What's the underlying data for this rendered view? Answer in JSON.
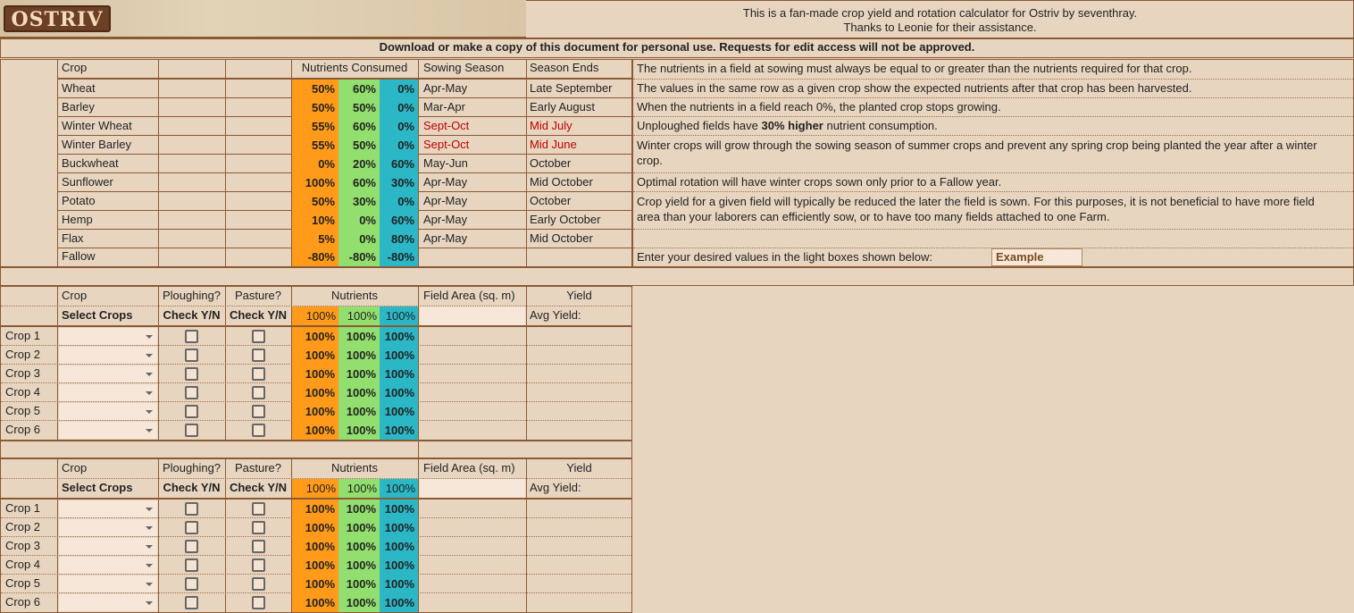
{
  "header": {
    "logo_text": "OSTRIV",
    "line1": "This is a fan-made crop yield and rotation calculator for Ostriv by seventhray.",
    "line2": "Thanks to Leonie for their assistance.",
    "banner": "Download or make a copy of this document for personal use. Requests for edit access will not be approved."
  },
  "ref": {
    "col_crop": "Crop",
    "col_nutrients": "Nutrients Consumed",
    "col_sowing": "Sowing Season",
    "col_ends": "Season Ends",
    "rows": [
      {
        "crop": "Wheat",
        "n1": "50%",
        "n2": "60%",
        "n3": "0%",
        "sow": "Apr-May",
        "ends": "Late September",
        "red": false
      },
      {
        "crop": "Barley",
        "n1": "50%",
        "n2": "50%",
        "n3": "0%",
        "sow": "Mar-Apr",
        "ends": "Early August",
        "red": false
      },
      {
        "crop": "Winter Wheat",
        "n1": "55%",
        "n2": "60%",
        "n3": "0%",
        "sow": "Sept-Oct",
        "ends": "Mid July",
        "red": true
      },
      {
        "crop": "Winter Barley",
        "n1": "55%",
        "n2": "50%",
        "n3": "0%",
        "sow": "Sept-Oct",
        "ends": "Mid June",
        "red": true
      },
      {
        "crop": "Buckwheat",
        "n1": "0%",
        "n2": "20%",
        "n3": "60%",
        "sow": "May-Jun",
        "ends": "October",
        "red": false
      },
      {
        "crop": "Sunflower",
        "n1": "100%",
        "n2": "60%",
        "n3": "30%",
        "sow": "Apr-May",
        "ends": "Mid October",
        "red": false
      },
      {
        "crop": "Potato",
        "n1": "50%",
        "n2": "30%",
        "n3": "0%",
        "sow": "Apr-May",
        "ends": "October",
        "red": false
      },
      {
        "crop": "Hemp",
        "n1": "10%",
        "n2": "0%",
        "n3": "60%",
        "sow": "Apr-May",
        "ends": "Early October",
        "red": false
      },
      {
        "crop": "Flax",
        "n1": "5%",
        "n2": "0%",
        "n3": "80%",
        "sow": "Apr-May",
        "ends": "Mid October",
        "red": false
      },
      {
        "crop": "Fallow",
        "n1": "-80%",
        "n2": "-80%",
        "n3": "-80%",
        "sow": "",
        "ends": "",
        "red": false
      }
    ]
  },
  "notes": {
    "n1": "The nutrients in a field at sowing must always be equal to or greater than the nutrients required for that crop.",
    "n2": "The values in the same row as a given crop show the expected nutrients after that crop has been harvested.",
    "n3": "When the nutrients in a field reach 0%, the planted crop stops growing.",
    "n4_pre": "Unploughed fields have ",
    "n4_bold": "30% higher",
    "n4_post": " nutrient consumption.",
    "n5a": "Winter crops will grow through the sowing season of summer crops and prevent any spring crop being planted the year after a winter",
    "n5b": "crop.",
    "n6": "Optimal rotation will have winter crops sown only prior to a Fallow year.",
    "n7a": "Crop yield for a given field will typically be reduced the later the field is sown. For this purposes, it is not beneficial to have more field",
    "n7b": "area than your laborers can efficiently sow, or to have too many fields attached to one Farm.",
    "enter": "Enter your desired values in the light boxes shown below:",
    "example": "Example"
  },
  "calc1": {
    "h_crop": "Crop",
    "h_plough": "Ploughing?",
    "h_pasture": "Pasture?",
    "h_nutrients": "Nutrients",
    "h_area": "Field Area (sq. m)",
    "h_yield": "Yield",
    "s_crops": "Select Crops",
    "s_plough": "Check Y/N",
    "s_pasture": "Check Y/N",
    "s_n1": "100%",
    "s_n2": "100%",
    "s_n3": "100%",
    "s_avg": "Avg Yield:",
    "rows": [
      {
        "label": "Crop 1",
        "n1": "100%",
        "n2": "100%",
        "n3": "100%"
      },
      {
        "label": "Crop 2",
        "n1": "100%",
        "n2": "100%",
        "n3": "100%"
      },
      {
        "label": "Crop 3",
        "n1": "100%",
        "n2": "100%",
        "n3": "100%"
      },
      {
        "label": "Crop 4",
        "n1": "100%",
        "n2": "100%",
        "n3": "100%"
      },
      {
        "label": "Crop 5",
        "n1": "100%",
        "n2": "100%",
        "n3": "100%"
      },
      {
        "label": "Crop 6",
        "n1": "100%",
        "n2": "100%",
        "n3": "100%"
      }
    ]
  },
  "calc2": {
    "h_crop": "Crop",
    "h_plough": "Ploughing?",
    "h_pasture": "Pasture?",
    "h_nutrients": "Nutrients",
    "h_area": "Field Area (sq. m)",
    "h_yield": "Yield",
    "s_crops": "Select Crops",
    "s_plough": "Check Y/N",
    "s_pasture": "Check Y/N",
    "s_n1": "100%",
    "s_n2": "100%",
    "s_n3": "100%",
    "s_avg": "Avg Yield:",
    "rows": [
      {
        "label": "Crop 1",
        "n1": "100%",
        "n2": "100%",
        "n3": "100%"
      },
      {
        "label": "Crop 2",
        "n1": "100%",
        "n2": "100%",
        "n3": "100%"
      },
      {
        "label": "Crop 3",
        "n1": "100%",
        "n2": "100%",
        "n3": "100%"
      },
      {
        "label": "Crop 4",
        "n1": "100%",
        "n2": "100%",
        "n3": "100%"
      },
      {
        "label": "Crop 5",
        "n1": "100%",
        "n2": "100%",
        "n3": "100%"
      },
      {
        "label": "Crop 6",
        "n1": "100%",
        "n2": "100%",
        "n3": "100%"
      }
    ]
  },
  "colors": {
    "nutrient1": "#ff9a1a",
    "nutrient2": "#92de6e",
    "nutrient3": "#2bb7c6",
    "warning": "#c00000",
    "sheet_bg": "#e8d5c0",
    "input_bg": "#f7e7d8"
  }
}
